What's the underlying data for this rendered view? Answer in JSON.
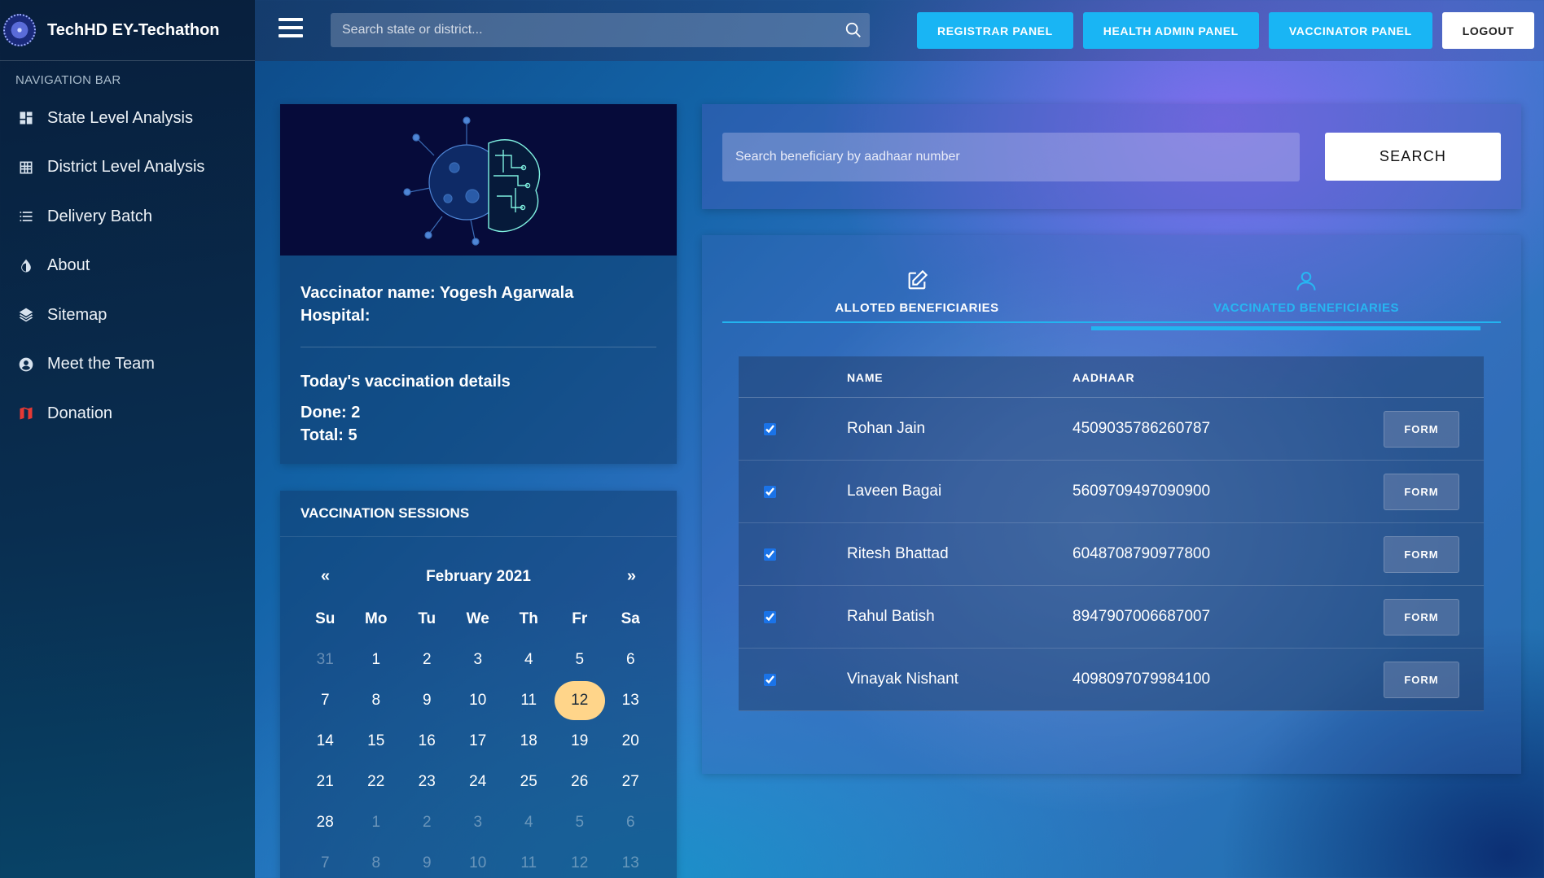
{
  "brand": {
    "title": "TechHD EY-Techathon"
  },
  "nav": {
    "caption": "NAVIGATION BAR",
    "items": [
      {
        "label": "State Level Analysis",
        "icon": "dashboard-icon"
      },
      {
        "label": "District Level Analysis",
        "icon": "grid-icon"
      },
      {
        "label": "Delivery Batch",
        "icon": "list-icon"
      },
      {
        "label": "About",
        "icon": "drop-icon"
      },
      {
        "label": "Sitemap",
        "icon": "layers-icon"
      },
      {
        "label": "Meet the Team",
        "icon": "account-circle-icon"
      },
      {
        "label": "Donation",
        "icon": "map-icon"
      }
    ]
  },
  "topbar": {
    "search_placeholder": "Search state or district...",
    "buttons": {
      "registrar": "REGISTRAR PANEL",
      "health_admin": "HEALTH ADMIN PANEL",
      "vaccinator": "VACCINATOR PANEL",
      "logout": "LOGOUT"
    }
  },
  "vaccinator": {
    "name_line": "Vaccinator name: Yogesh Agarwala",
    "hospital_line": "Hospital:",
    "details_title": "Today's vaccination details",
    "done_line": "Done: 2",
    "total_line": "Total: 5"
  },
  "sessions": {
    "title": "VACCINATION SESSIONS",
    "month": "February 2021",
    "prev": "«",
    "next": "»",
    "weekdays": [
      "Su",
      "Mo",
      "Tu",
      "We",
      "Th",
      "Fr",
      "Sa"
    ],
    "days": [
      [
        "31",
        "1",
        "2",
        "3",
        "4",
        "5",
        "6"
      ],
      [
        "7",
        "8",
        "9",
        "10",
        "11",
        "12",
        "13"
      ],
      [
        "14",
        "15",
        "16",
        "17",
        "18",
        "19",
        "20"
      ],
      [
        "21",
        "22",
        "23",
        "24",
        "25",
        "26",
        "27"
      ],
      [
        "28",
        "1",
        "2",
        "3",
        "4",
        "5",
        "6"
      ],
      [
        "7",
        "8",
        "9",
        "10",
        "11",
        "12",
        "13"
      ]
    ],
    "selected": "12",
    "highlight_color": "#ffd58a"
  },
  "beneficiary_search": {
    "placeholder": "Search beneficiary by aadhaar number",
    "button": "SEARCH"
  },
  "tabs": {
    "alloted": "ALLOTED BENEFICIARIES",
    "vaccinated": "VACCINATED BENEFICIARIES",
    "active_color": "#23b4f0"
  },
  "table": {
    "headers": {
      "name": "NAME",
      "aadhaar": "AADHAAR"
    },
    "form_label": "FORM",
    "rows": [
      {
        "name": "Rohan Jain",
        "aadhaar": "4509035786260787",
        "checked": true
      },
      {
        "name": "Laveen Bagai",
        "aadhaar": "5609709497090900",
        "checked": true
      },
      {
        "name": "Ritesh Bhattad",
        "aadhaar": "6048708790977800",
        "checked": true
      },
      {
        "name": "Rahul Batish",
        "aadhaar": "8947907006687007",
        "checked": true
      },
      {
        "name": "Vinayak Nishant",
        "aadhaar": "4098097079984100",
        "checked": true
      }
    ]
  },
  "colors": {
    "accent": "#19b5f4",
    "sidebar": "#0a2440"
  }
}
